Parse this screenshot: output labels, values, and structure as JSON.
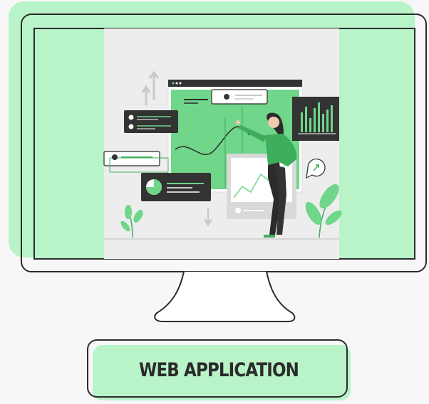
{
  "label": {
    "text": "WEB APPLICATION"
  },
  "colors": {
    "accent": "#b9f3c8",
    "accent_mid": "#6fd68a",
    "accent_dark": "#3fae5c",
    "outline": "#2b2b2b",
    "panel": "#ededed",
    "dark_card": "#333333"
  }
}
